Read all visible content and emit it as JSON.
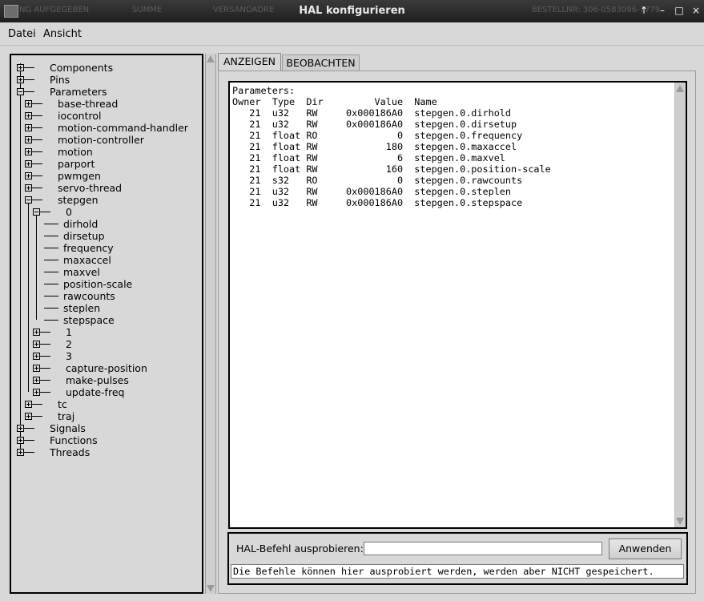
{
  "window": {
    "title": "HAL konfigurieren",
    "background_ghost_text": [
      "NG AUFGEGEBEN",
      "SUMME",
      "VERSANDADRE",
      "BESTELLNR: 306-0583096-7779"
    ],
    "buttons": [
      "↑",
      "–",
      "□",
      "×"
    ]
  },
  "menu": {
    "items": [
      "Datei",
      "Ansicht"
    ]
  },
  "tree": {
    "nodes": [
      {
        "label": "Components",
        "depth": 0,
        "toggle": "plus"
      },
      {
        "label": "Pins",
        "depth": 0,
        "toggle": "plus"
      },
      {
        "label": "Parameters",
        "depth": 0,
        "toggle": "minus"
      },
      {
        "label": "base-thread",
        "depth": 1,
        "toggle": "plus"
      },
      {
        "label": "iocontrol",
        "depth": 1,
        "toggle": "plus"
      },
      {
        "label": "motion-command-handler",
        "depth": 1,
        "toggle": "plus"
      },
      {
        "label": "motion-controller",
        "depth": 1,
        "toggle": "plus"
      },
      {
        "label": "motion",
        "depth": 1,
        "toggle": "plus"
      },
      {
        "label": "parport",
        "depth": 1,
        "toggle": "plus"
      },
      {
        "label": "pwmgen",
        "depth": 1,
        "toggle": "plus"
      },
      {
        "label": "servo-thread",
        "depth": 1,
        "toggle": "plus"
      },
      {
        "label": "stepgen",
        "depth": 1,
        "toggle": "minus"
      },
      {
        "label": "0",
        "depth": 2,
        "toggle": "minus"
      },
      {
        "label": "dirhold",
        "depth": 3,
        "toggle": "none"
      },
      {
        "label": "dirsetup",
        "depth": 3,
        "toggle": "none"
      },
      {
        "label": "frequency",
        "depth": 3,
        "toggle": "none"
      },
      {
        "label": "maxaccel",
        "depth": 3,
        "toggle": "none"
      },
      {
        "label": "maxvel",
        "depth": 3,
        "toggle": "none"
      },
      {
        "label": "position-scale",
        "depth": 3,
        "toggle": "none"
      },
      {
        "label": "rawcounts",
        "depth": 3,
        "toggle": "none"
      },
      {
        "label": "steplen",
        "depth": 3,
        "toggle": "none"
      },
      {
        "label": "stepspace",
        "depth": 3,
        "toggle": "none"
      },
      {
        "label": "1",
        "depth": 2,
        "toggle": "plus"
      },
      {
        "label": "2",
        "depth": 2,
        "toggle": "plus"
      },
      {
        "label": "3",
        "depth": 2,
        "toggle": "plus"
      },
      {
        "label": "capture-position",
        "depth": 2,
        "toggle": "plus"
      },
      {
        "label": "make-pulses",
        "depth": 2,
        "toggle": "plus"
      },
      {
        "label": "update-freq",
        "depth": 2,
        "toggle": "plus"
      },
      {
        "label": "tc",
        "depth": 1,
        "toggle": "plus"
      },
      {
        "label": "traj",
        "depth": 1,
        "toggle": "plus"
      },
      {
        "label": "Signals",
        "depth": 0,
        "toggle": "plus"
      },
      {
        "label": "Functions",
        "depth": 0,
        "toggle": "plus"
      },
      {
        "label": "Threads",
        "depth": 0,
        "toggle": "plus"
      }
    ]
  },
  "tabs": {
    "active": "ANZEIGEN",
    "inactive": "BEOBACHTEN"
  },
  "params_view": {
    "heading": "Parameters:",
    "columns": [
      "Owner",
      "Type",
      "Dir",
      "Value",
      "Name"
    ],
    "rows": [
      [
        "21",
        "u32",
        "RW",
        "0x000186A0",
        "stepgen.0.dirhold"
      ],
      [
        "21",
        "u32",
        "RW",
        "0x000186A0",
        "stepgen.0.dirsetup"
      ],
      [
        "21",
        "float",
        "RO",
        "0",
        "stepgen.0.frequency"
      ],
      [
        "21",
        "float",
        "RW",
        "180",
        "stepgen.0.maxaccel"
      ],
      [
        "21",
        "float",
        "RW",
        "6",
        "stepgen.0.maxvel"
      ],
      [
        "21",
        "float",
        "RW",
        "160",
        "stepgen.0.position-scale"
      ],
      [
        "21",
        "s32",
        "RO",
        "0",
        "stepgen.0.rawcounts"
      ],
      [
        "21",
        "u32",
        "RW",
        "0x000186A0",
        "stepgen.0.steplen"
      ],
      [
        "21",
        "u32",
        "RW",
        "0x000186A0",
        "stepgen.0.stepspace"
      ]
    ]
  },
  "command": {
    "label": "HAL-Befehl ausprobieren:",
    "value": "",
    "run_label": "Anwenden",
    "status": "Die Befehle können hier ausprobiert werden, werden aber NICHT gespeichert."
  }
}
